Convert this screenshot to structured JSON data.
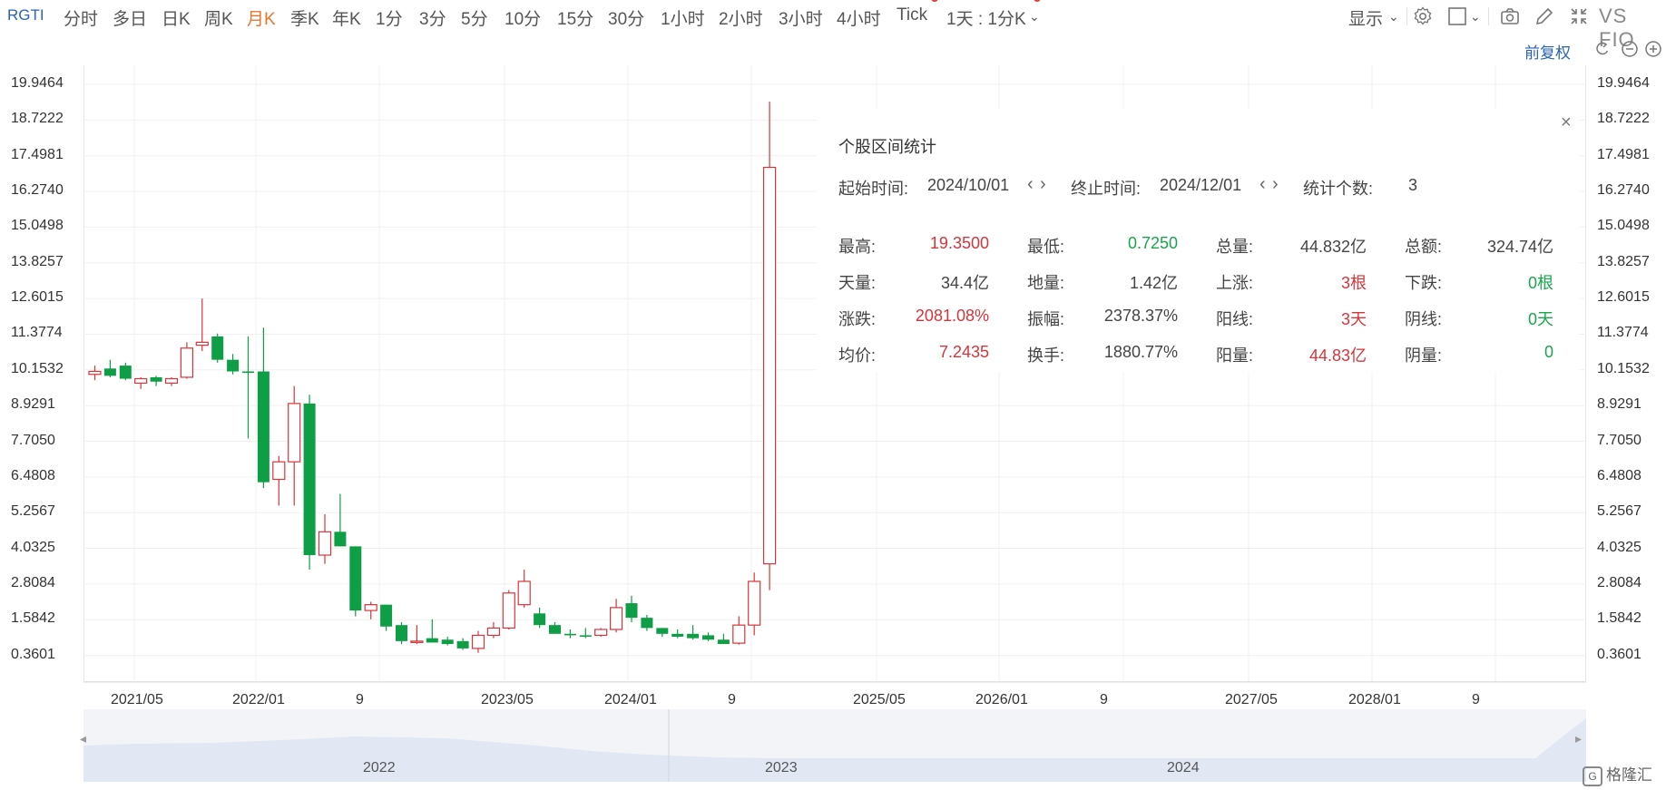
{
  "toolbar": {
    "symbol": "RGTI",
    "periods": [
      "分时",
      "多日",
      "日K",
      "周K",
      "月K",
      "季K",
      "年K",
      "1分",
      "3分",
      "5分",
      "10分",
      "15分",
      "30分",
      "1小时",
      "2小时",
      "3小时",
      "4小时",
      "Tick"
    ],
    "active_period": "月K",
    "combo": "1天 : 1分K",
    "display": "显示",
    "compare": "VS FIO",
    "icons": [
      "settings-icon",
      "checkbox-icon",
      "camera-icon",
      "pencil-icon",
      "fullscreen-icon"
    ]
  },
  "adjust": {
    "label": "前复权",
    "icons": [
      "undo-icon",
      "zoom-out-icon",
      "zoom-in-icon"
    ]
  },
  "y_axis": [
    "19.9464",
    "18.7222",
    "17.4981",
    "16.2740",
    "15.0498",
    "13.8257",
    "12.6015",
    "11.3774",
    "10.1532",
    "8.9291",
    "7.7050",
    "6.4808",
    "5.2567",
    "4.0325",
    "2.8084",
    "1.5842",
    "0.3601"
  ],
  "x_axis": [
    "2021/05",
    "2022/01",
    "9",
    "2023/05",
    "2024/01",
    "9",
    "2025/05",
    "2026/01",
    "9",
    "2027/05",
    "2028/01",
    "9"
  ],
  "navigator": {
    "years": [
      "2022",
      "2023",
      "2024"
    ]
  },
  "stats": {
    "title": "个股区间统计",
    "start_label": "起始时间:",
    "start_value": "2024/10/01",
    "end_label": "终止时间:",
    "end_value": "2024/12/01",
    "count_label": "统计个数:",
    "count_value": "3",
    "close": "×",
    "rows": [
      [
        {
          "label": "最高:",
          "value": "19.3500",
          "color": "red"
        },
        {
          "label": "最低:",
          "value": "0.7250",
          "color": "green"
        },
        {
          "label": "总量:",
          "value": "44.832亿",
          "color": "dark"
        },
        {
          "label": "总额:",
          "value": "324.74亿",
          "color": "dark"
        }
      ],
      [
        {
          "label": "天量:",
          "value": "34.4亿",
          "color": "dark"
        },
        {
          "label": "地量:",
          "value": "1.42亿",
          "color": "dark"
        },
        {
          "label": "上涨:",
          "value": "3根",
          "color": "red"
        },
        {
          "label": "下跌:",
          "value": "0根",
          "color": "green"
        }
      ],
      [
        {
          "label": "涨跌:",
          "value": "2081.08%",
          "color": "red"
        },
        {
          "label": "振幅:",
          "value": "2378.37%",
          "color": "dark"
        },
        {
          "label": "阳线:",
          "value": "3天",
          "color": "red"
        },
        {
          "label": "阴线:",
          "value": "0天",
          "color": "green"
        }
      ],
      [
        {
          "label": "均价:",
          "value": "7.2435",
          "color": "red"
        },
        {
          "label": "换手:",
          "value": "1880.77%",
          "color": "dark"
        },
        {
          "label": "阳量:",
          "value": "44.83亿",
          "color": "red"
        },
        {
          "label": "阴量:",
          "value": "0",
          "color": "green"
        }
      ]
    ]
  },
  "colors": {
    "up": "#d7353a",
    "down": "#0e9e45",
    "accent": "#2a63b0",
    "active": "#e8762d"
  },
  "chart_data": {
    "type": "candlestick",
    "candles": [
      {
        "o": 10.0,
        "h": 10.3,
        "l": 9.8,
        "c": 10.1
      },
      {
        "o": 10.2,
        "h": 10.5,
        "l": 9.9,
        "c": 9.95
      },
      {
        "o": 10.3,
        "h": 10.4,
        "l": 9.8,
        "c": 9.85
      },
      {
        "o": 9.7,
        "h": 9.9,
        "l": 9.5,
        "c": 9.85
      },
      {
        "o": 9.9,
        "h": 9.95,
        "l": 9.6,
        "c": 9.75
      },
      {
        "o": 9.7,
        "h": 9.9,
        "l": 9.6,
        "c": 9.85
      },
      {
        "o": 9.9,
        "h": 11.1,
        "l": 9.85,
        "c": 10.9
      },
      {
        "o": 11.0,
        "h": 12.6,
        "l": 10.8,
        "c": 11.1
      },
      {
        "o": 11.3,
        "h": 11.4,
        "l": 10.4,
        "c": 10.5
      },
      {
        "o": 10.5,
        "h": 10.7,
        "l": 10.0,
        "c": 10.1
      },
      {
        "o": 10.1,
        "h": 11.3,
        "l": 7.8,
        "c": 10.05
      },
      {
        "o": 10.1,
        "h": 11.6,
        "l": 6.1,
        "c": 6.3
      },
      {
        "o": 6.4,
        "h": 7.2,
        "l": 5.5,
        "c": 7.0
      },
      {
        "o": 7.0,
        "h": 9.6,
        "l": 5.5,
        "c": 9.0
      },
      {
        "o": 9.0,
        "h": 9.3,
        "l": 3.3,
        "c": 3.8
      },
      {
        "o": 3.8,
        "h": 5.2,
        "l": 3.5,
        "c": 4.6
      },
      {
        "o": 4.6,
        "h": 5.9,
        "l": 4.1,
        "c": 4.1
      },
      {
        "o": 4.1,
        "h": 4.1,
        "l": 1.7,
        "c": 1.9
      },
      {
        "o": 1.9,
        "h": 2.2,
        "l": 1.6,
        "c": 2.1
      },
      {
        "o": 2.1,
        "h": 2.1,
        "l": 1.2,
        "c": 1.35
      },
      {
        "o": 1.4,
        "h": 1.5,
        "l": 0.75,
        "c": 0.85
      },
      {
        "o": 0.85,
        "h": 1.4,
        "l": 0.75,
        "c": 0.85
      },
      {
        "o": 0.95,
        "h": 1.6,
        "l": 0.8,
        "c": 0.8
      },
      {
        "o": 0.9,
        "h": 1.0,
        "l": 0.7,
        "c": 0.75
      },
      {
        "o": 0.85,
        "h": 0.95,
        "l": 0.55,
        "c": 0.6
      },
      {
        "o": 0.6,
        "h": 1.2,
        "l": 0.45,
        "c": 1.05
      },
      {
        "o": 1.05,
        "h": 1.5,
        "l": 0.95,
        "c": 1.3
      },
      {
        "o": 1.3,
        "h": 2.6,
        "l": 1.25,
        "c": 2.5
      },
      {
        "o": 2.1,
        "h": 3.3,
        "l": 2.0,
        "c": 2.9
      },
      {
        "o": 1.8,
        "h": 2.0,
        "l": 1.3,
        "c": 1.4
      },
      {
        "o": 1.4,
        "h": 1.5,
        "l": 1.1,
        "c": 1.1
      },
      {
        "o": 1.1,
        "h": 1.25,
        "l": 0.95,
        "c": 1.05
      },
      {
        "o": 1.05,
        "h": 1.3,
        "l": 0.95,
        "c": 1.0
      },
      {
        "o": 1.05,
        "h": 1.3,
        "l": 1.0,
        "c": 1.25
      },
      {
        "o": 1.25,
        "h": 2.3,
        "l": 1.15,
        "c": 2.0
      },
      {
        "o": 2.15,
        "h": 2.4,
        "l": 1.5,
        "c": 1.65
      },
      {
        "o": 1.65,
        "h": 1.75,
        "l": 1.2,
        "c": 1.3
      },
      {
        "o": 1.3,
        "h": 1.3,
        "l": 1.0,
        "c": 1.1
      },
      {
        "o": 1.1,
        "h": 1.25,
        "l": 0.95,
        "c": 1.0
      },
      {
        "o": 1.1,
        "h": 1.4,
        "l": 0.9,
        "c": 0.95
      },
      {
        "o": 1.05,
        "h": 1.15,
        "l": 0.85,
        "c": 0.9
      },
      {
        "o": 0.9,
        "h": 1.1,
        "l": 0.8,
        "c": 0.75
      },
      {
        "o": 0.78,
        "h": 1.7,
        "l": 0.73,
        "c": 1.4
      },
      {
        "o": 1.4,
        "h": 3.2,
        "l": 1.05,
        "c": 2.9
      },
      {
        "o": 3.5,
        "h": 19.35,
        "l": 2.6,
        "c": 17.1
      }
    ],
    "ylim": [
      0.3601,
      19.9464
    ]
  }
}
